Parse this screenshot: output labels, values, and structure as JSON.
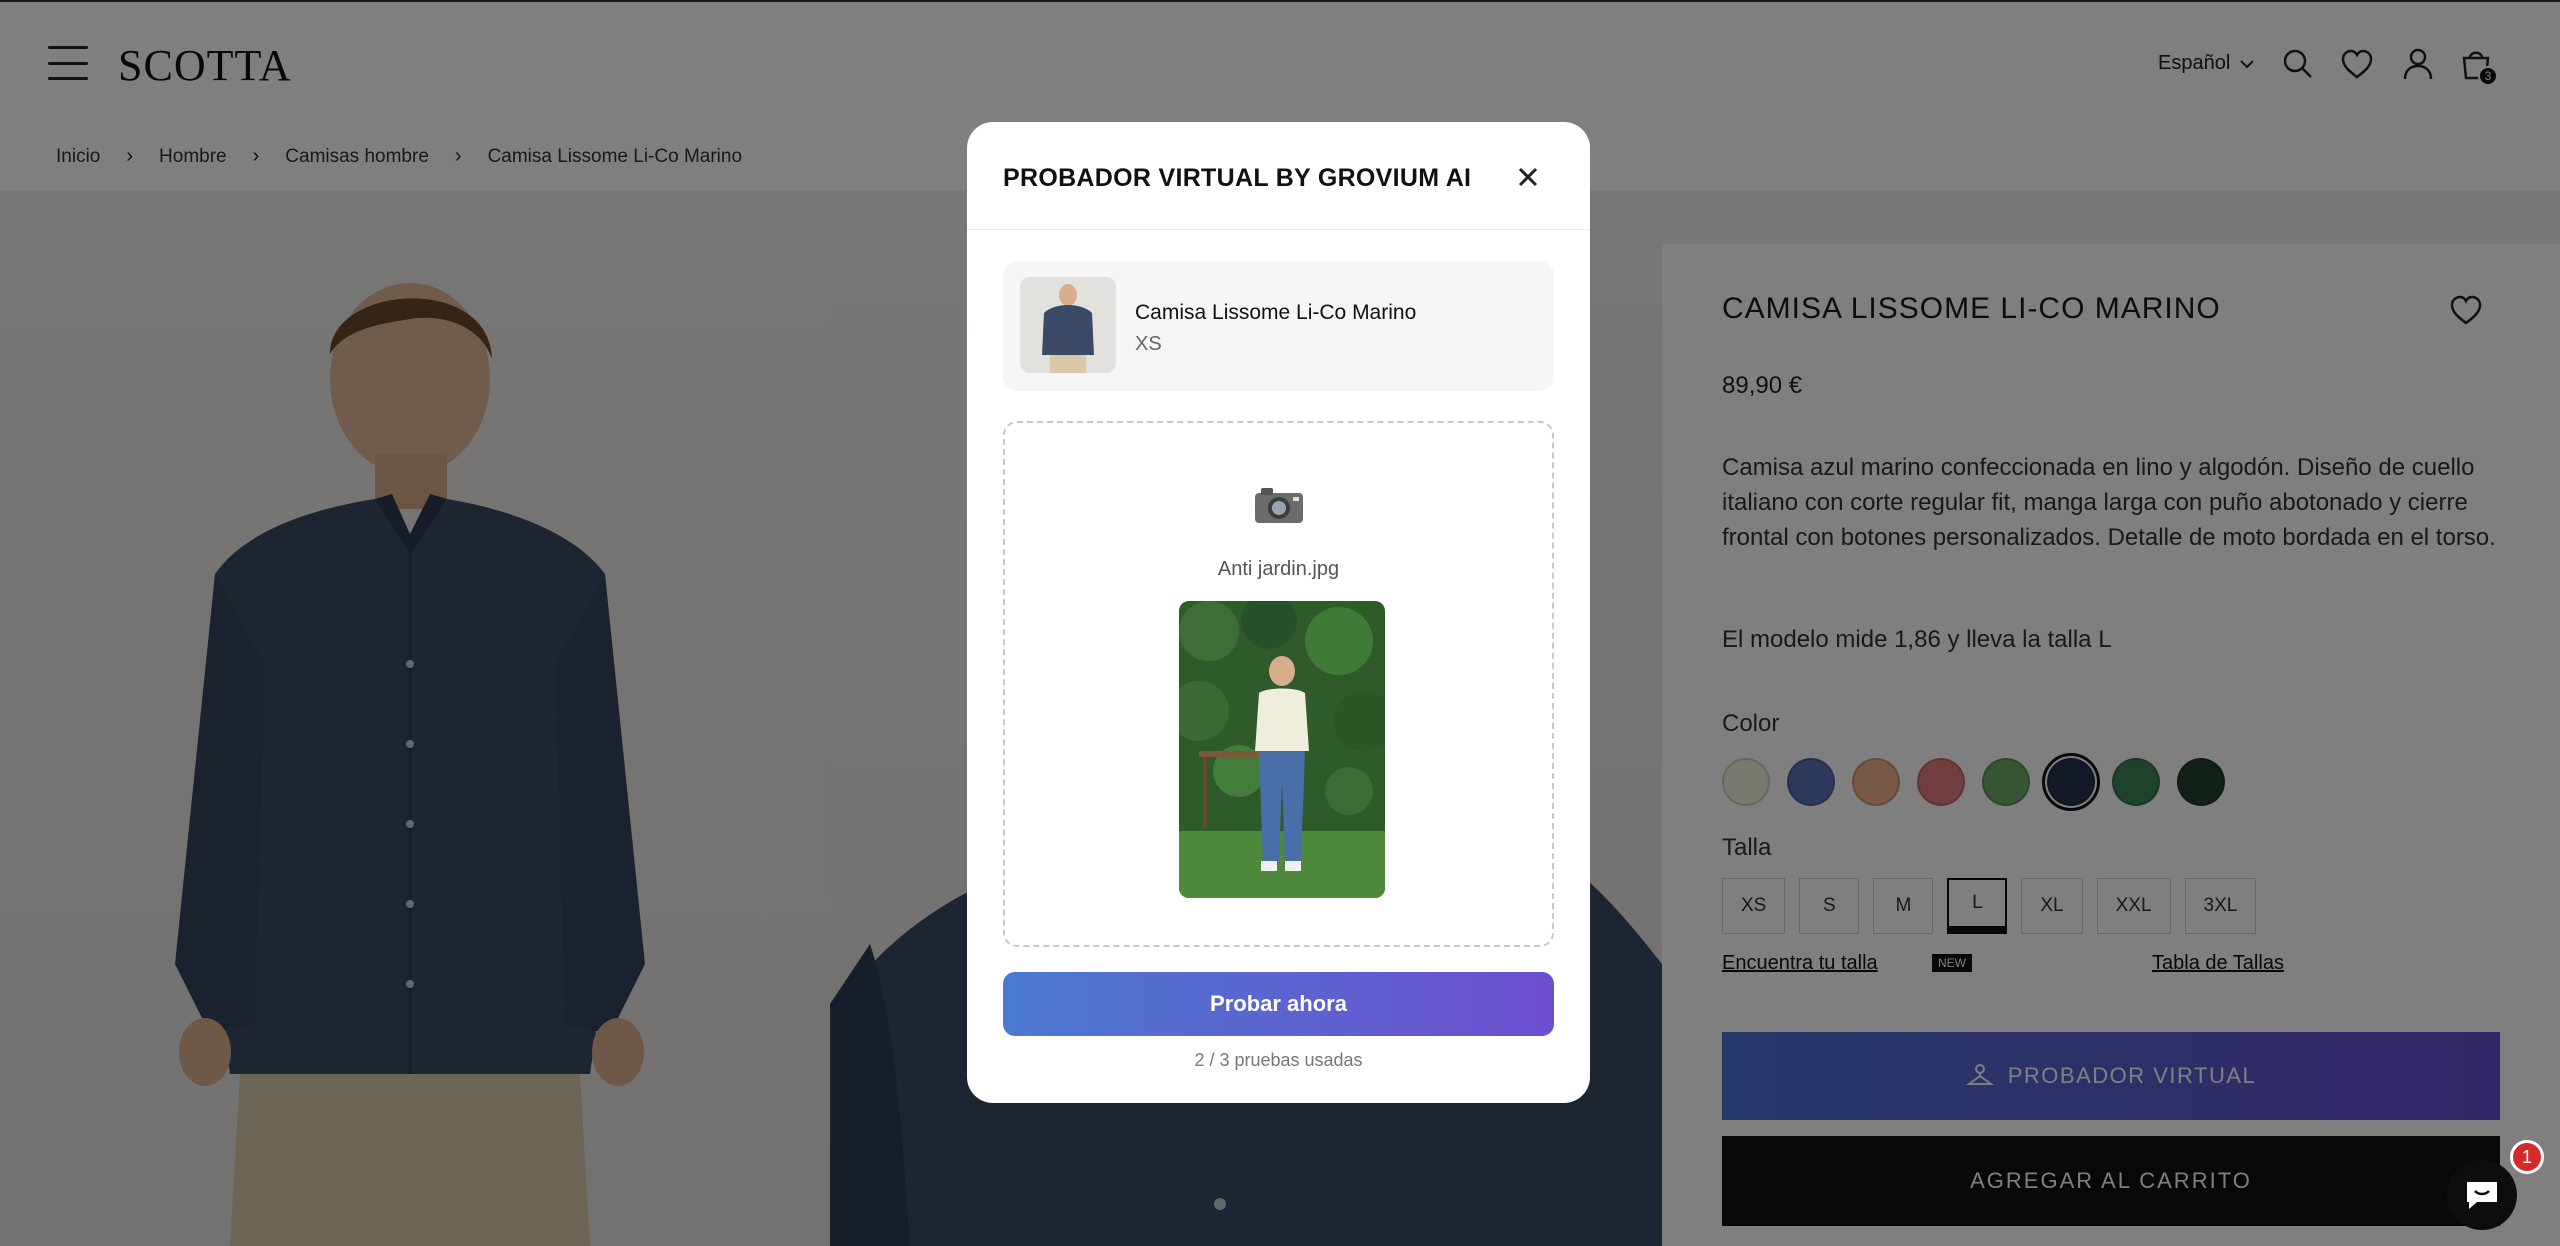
{
  "header": {
    "logo": "SCOTTA",
    "language": "Español",
    "cart_count": "3"
  },
  "breadcrumb": [
    "Inicio",
    "Hombre",
    "Camisas hombre",
    "Camisa Lissome Li-Co Marino"
  ],
  "product": {
    "title": "CAMISA LISSOME LI-CO MARINO",
    "price": "89,90 €",
    "description": "Camisa azul marino confeccionada en lino y algodón. Diseño de cuello italiano con corte regular fit, manga larga con puño abotonado y cierre frontal con botones personalizados. Detalle de moto bordada en el torso.",
    "model_info": "El modelo mide 1,86 y lleva la talla L",
    "color_label": "Color",
    "colors": [
      "#f1f3df",
      "#5a73b8",
      "#efb28c",
      "#e37e7e",
      "#6fa869",
      "#26324f",
      "#3f855b",
      "#244331"
    ],
    "selected_color_index": 5,
    "size_label": "Talla",
    "sizes": [
      "XS",
      "S",
      "M",
      "L",
      "XL",
      "XXL",
      "3XL"
    ],
    "selected_size": "L",
    "find_size_link": "Encuentra tu talla",
    "new_badge": "NEW",
    "size_table_link": "Tabla de Tallas",
    "virtual_tryon_button": "PROBADOR VIRTUAL",
    "add_to_cart_button": "AGREGAR AL CARRITO"
  },
  "modal": {
    "title": "PROBADOR VIRTUAL BY GROVIUM AI",
    "product_name": "Camisa Lissome Li-Co Marino",
    "product_size": "XS",
    "uploaded_filename": "Anti jardin.jpg",
    "try_button": "Probar ahora",
    "usage": "2 / 3 pruebas usadas"
  },
  "chat": {
    "badge_count": "1"
  },
  "colors": {
    "overlay": "rgba(0,0,0,0.5)",
    "button_gradient_start": "#4b7ad1",
    "button_gradient_end": "#6d4ecf",
    "cart_button": "#111111"
  }
}
